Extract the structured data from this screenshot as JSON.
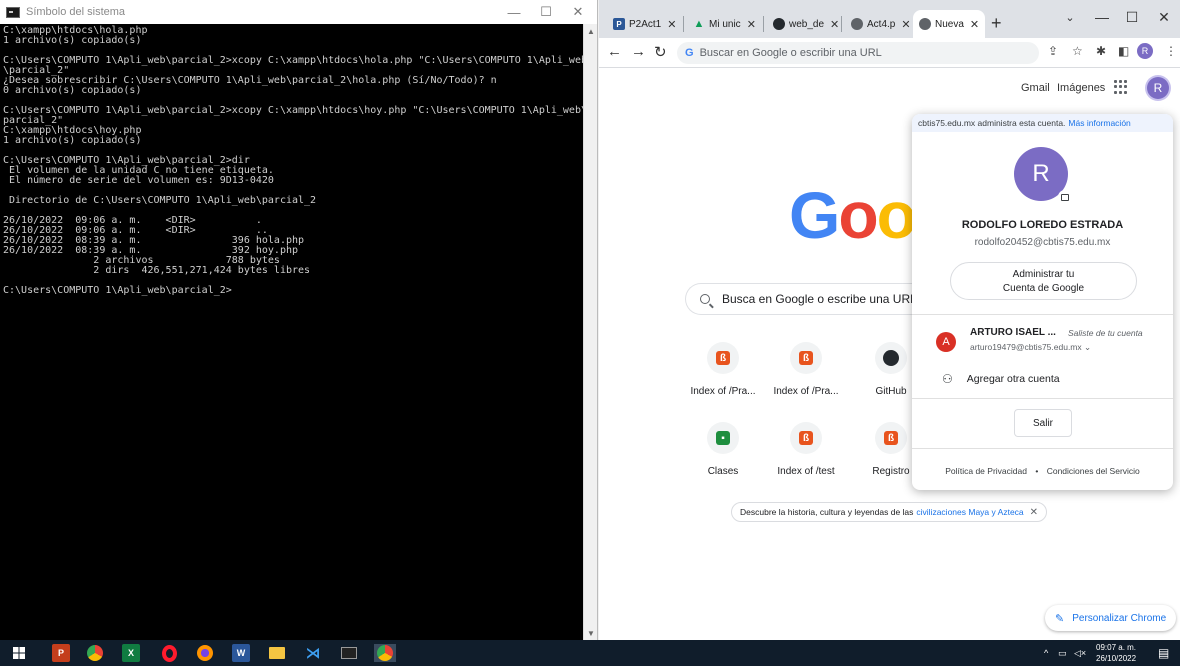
{
  "cmd": {
    "title": "Símbolo del sistema",
    "lines": [
      "C:\\xampp\\htdocs\\hola.php",
      "1 archivo(s) copiado(s)",
      "",
      "C:\\Users\\COMPUTO 1\\Apli_web\\parcial_2>xcopy C:\\xampp\\htdocs\\hola.php \"C:\\Users\\COMPUTO 1\\Apli_web",
      "\\parcial_2\"",
      "¿Desea sobrescribir C:\\Users\\COMPUTO 1\\Apli_web\\parcial_2\\hola.php (Sí/No/Todo)? n",
      "0 archivo(s) copiado(s)",
      "",
      "C:\\Users\\COMPUTO 1\\Apli_web\\parcial_2>xcopy C:\\xampp\\htdocs\\hoy.php \"C:\\Users\\COMPUTO 1\\Apli_web\\",
      "parcial_2\"",
      "C:\\xampp\\htdocs\\hoy.php",
      "1 archivo(s) copiado(s)",
      "",
      "C:\\Users\\COMPUTO 1\\Apli_web\\parcial_2>dir",
      " El volumen de la unidad C no tiene etiqueta.",
      " El número de serie del volumen es: 9D13-0420",
      "",
      " Directorio de C:\\Users\\COMPUTO 1\\Apli_web\\parcial_2",
      "",
      "26/10/2022  09:06 a. m.    <DIR>          .",
      "26/10/2022  09:06 a. m.    <DIR>          ..",
      "26/10/2022  08:39 a. m.               396 hola.php",
      "26/10/2022  08:39 a. m.               392 hoy.php",
      "               2 archivos            788 bytes",
      "               2 dirs  426,551,271,424 bytes libres",
      "",
      "C:\\Users\\COMPUTO 1\\Apli_web\\parcial_2>"
    ],
    "minimize": "—",
    "maximize": "☐",
    "close": "✕"
  },
  "chrome": {
    "tabs": [
      {
        "label": "P2Act1",
        "fav": "P",
        "color": "#2b5797"
      },
      {
        "label": "Mi unic",
        "fav": "▲",
        "color": "#0f9d58"
      },
      {
        "label": "web_de",
        "fav": "●",
        "color": "#24292e"
      },
      {
        "label": "Act4.p",
        "fav": "●",
        "color": "#5f6368"
      },
      {
        "label": "Nueva",
        "fav": "●",
        "color": "#5f6368"
      }
    ],
    "tab_close": "✕",
    "new_tab": "+",
    "omnibox_placeholder": "Buscar en Google o escribir una URL",
    "omnibox_g": "G",
    "profile_initial": "R",
    "gmail": "Gmail",
    "images": "Imágenes",
    "search_placeholder": "Busca en Google o escribe una URL",
    "shortcuts": [
      {
        "label": "Index of /Pra..."
      },
      {
        "label": "Index of /Pra..."
      },
      {
        "label": "GitHub"
      },
      {
        "label": "Clases"
      },
      {
        "label": "Index of /test"
      },
      {
        "label": "Registro"
      }
    ],
    "doodle_text": "Descubre la historia, cultura y leyendas de las",
    "doodle_link": "civilizaciones Maya y Azteca",
    "customize": "Personalizar Chrome"
  },
  "account": {
    "banner": "cbtis75.edu.mx administra esta cuenta.",
    "banner_link": "Más información",
    "initial": "R",
    "name": "RODOLFO LOREDO ESTRADA",
    "email": "rodolfo20452@cbtis75.edu.mx",
    "manage_line1": "Administrar tu",
    "manage_line2": "Cuenta de Google",
    "other_initial": "A",
    "other_name": "ARTURO ISAEL ...",
    "other_status": "Saliste de tu cuenta",
    "other_email": "arturo19479@cbtis75.edu.mx",
    "add_account": "Agregar otra cuenta",
    "sign_out": "Salir",
    "privacy": "Política de Privacidad",
    "terms": "Condiciones del Servicio"
  },
  "taskbar": {
    "time": "09:07 a. m.",
    "date": "26/10/2022"
  }
}
